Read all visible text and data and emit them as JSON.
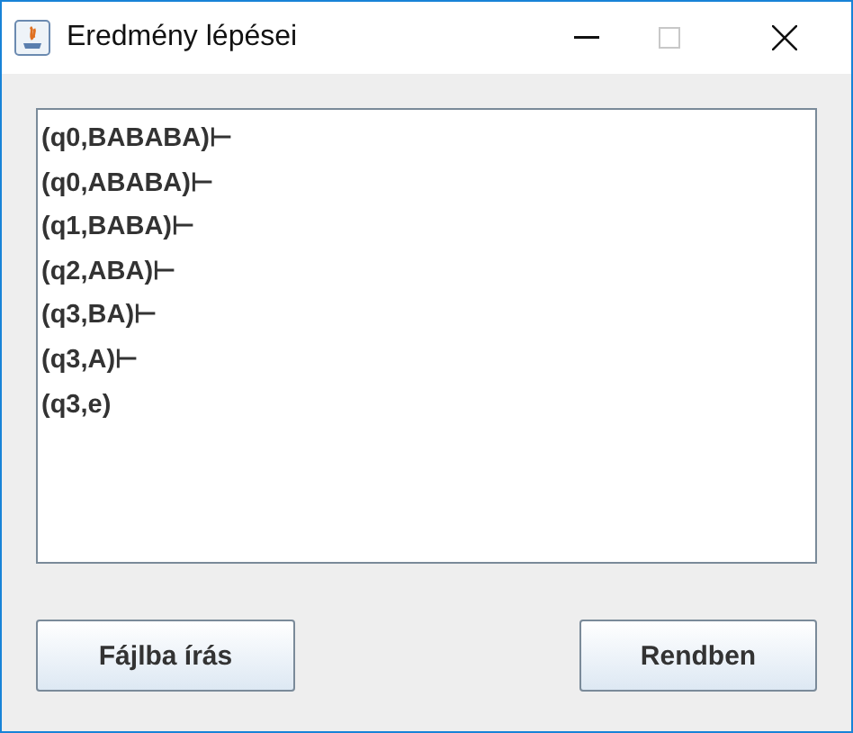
{
  "window": {
    "title": "Eredmény lépései",
    "maximize_disabled": true
  },
  "steps": [
    "(q0,BABABA)⊢",
    "(q0,ABABA)⊢",
    "(q1,BABA)⊢",
    "(q2,ABA)⊢",
    "(q3,BA)⊢",
    "(q3,A)⊢",
    "(q3,e)"
  ],
  "buttons": [
    "Fájlba írás",
    "Rendben"
  ]
}
